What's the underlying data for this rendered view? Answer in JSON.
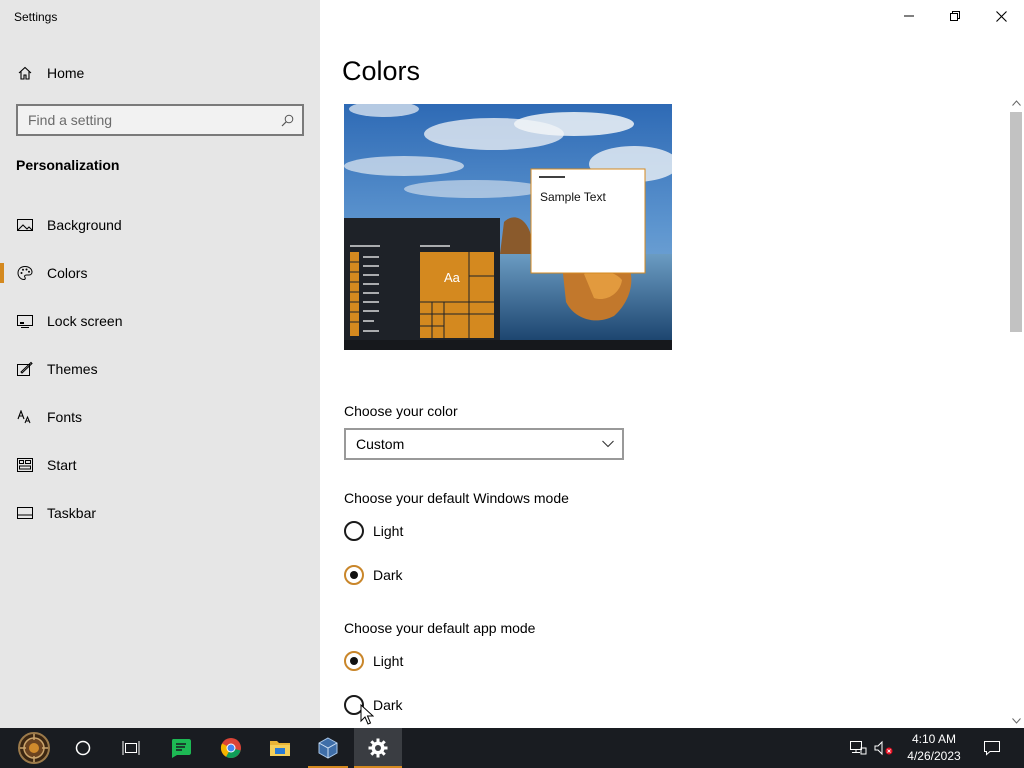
{
  "window": {
    "app_title": "Settings",
    "controls": {
      "minimize": "minimize-icon",
      "restore": "restore-icon",
      "close": "close-icon"
    }
  },
  "sidebar": {
    "home_label": "Home",
    "search_placeholder": "Find a setting",
    "section_title": "Personalization",
    "items": [
      {
        "label": "Background",
        "icon": "picture-icon",
        "active": false
      },
      {
        "label": "Colors",
        "icon": "palette-icon",
        "active": true
      },
      {
        "label": "Lock screen",
        "icon": "lock-screen-icon",
        "active": false
      },
      {
        "label": "Themes",
        "icon": "themes-icon",
        "active": false
      },
      {
        "label": "Fonts",
        "icon": "fonts-icon",
        "active": false
      },
      {
        "label": "Start",
        "icon": "start-icon",
        "active": false
      },
      {
        "label": "Taskbar",
        "icon": "taskbar-icon",
        "active": false
      }
    ]
  },
  "main": {
    "title": "Colors",
    "preview": {
      "sample_text": "Sample Text",
      "tile_text": "Aa"
    },
    "choose_color": {
      "label": "Choose your color",
      "selected": "Custom"
    },
    "windows_mode": {
      "label": "Choose your default Windows mode",
      "options": [
        {
          "label": "Light",
          "checked": false
        },
        {
          "label": "Dark",
          "checked": true
        }
      ]
    },
    "app_mode": {
      "label": "Choose your default app mode",
      "options": [
        {
          "label": "Light",
          "checked": true
        },
        {
          "label": "Dark",
          "checked": false
        }
      ]
    }
  },
  "taskbar": {
    "apps": [
      "start-icon",
      "cortana-icon",
      "task-view-icon",
      "chat-icon",
      "chrome-icon",
      "file-explorer-icon",
      "virtualbox-icon",
      "settings-icon"
    ],
    "tray": [
      "network-icon",
      "volume-muted-icon"
    ],
    "time": "4:10 AM",
    "date": "4/26/2023"
  },
  "colors": {
    "accent": "#d4891f",
    "sidebar_bg": "#e6e6e6",
    "taskbar_bg": "#191c21"
  }
}
